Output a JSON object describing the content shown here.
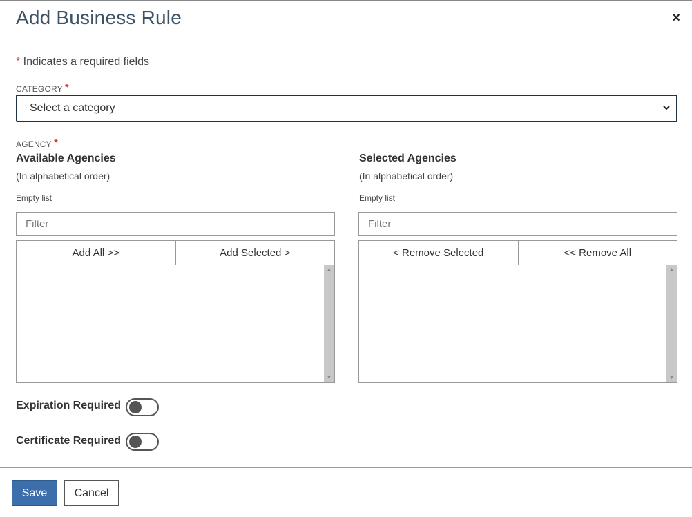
{
  "header": {
    "title": "Add Business Rule",
    "close_symbol": "×"
  },
  "required_note": {
    "star": "*",
    "text": " Indicates a required fields"
  },
  "category": {
    "label": "CATEGORY",
    "star": "*",
    "selected": "Select a category",
    "chevron": "⌄"
  },
  "agency": {
    "label": "AGENCY",
    "star": "*",
    "available": {
      "title": "Available Agencies",
      "subtitle": "(In alphabetical order)",
      "empty_text": "Empty list",
      "filter_placeholder": "Filter",
      "buttons": [
        "Add All >>",
        "Add Selected >"
      ],
      "items": []
    },
    "selected": {
      "title": "Selected Agencies",
      "subtitle": "(In alphabetical order)",
      "empty_text": "Empty list",
      "filter_placeholder": "Filter",
      "buttons": [
        "< Remove Selected",
        "<< Remove All"
      ],
      "items": []
    }
  },
  "toggles": [
    {
      "label": "Expiration Required",
      "on": false
    },
    {
      "label": "Certificate Required",
      "on": false
    }
  ],
  "footer": {
    "save_label": "Save",
    "cancel_label": "Cancel"
  },
  "colors": {
    "title": "#3e5366",
    "required_star": "#c9302c",
    "primary_button": "#3c6eab"
  },
  "icons": {
    "close": "close-icon",
    "select_chevron": "chevron-down-icon",
    "toggle_knob": "toggle-knob-icon"
  }
}
